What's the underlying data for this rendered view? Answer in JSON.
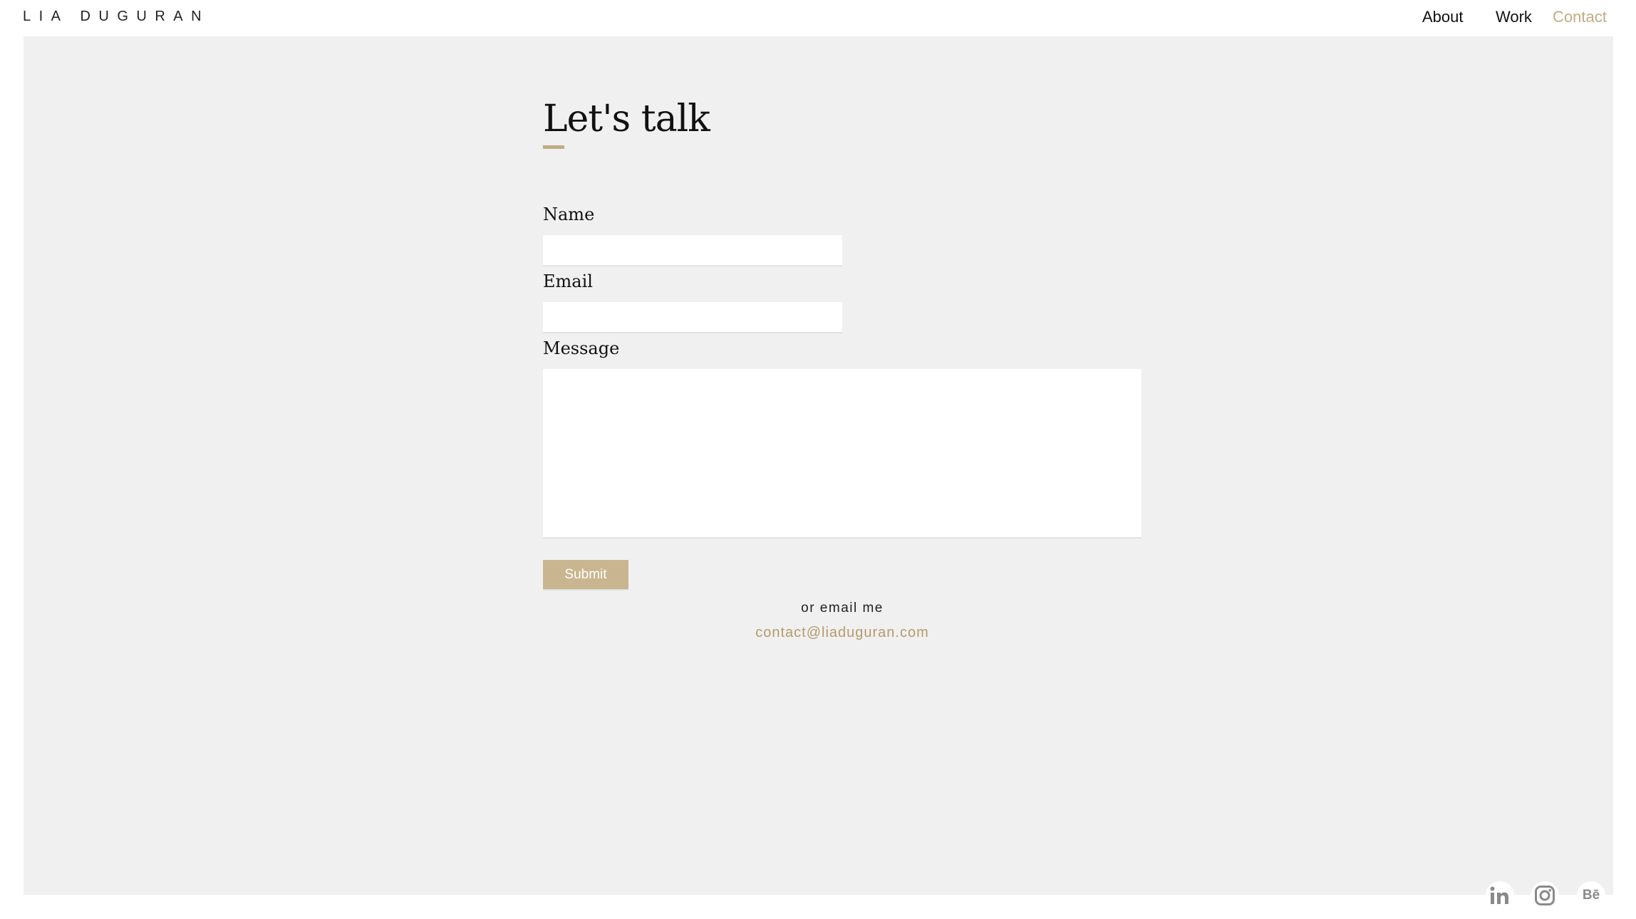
{
  "header": {
    "brand": "LIA DUGURAN",
    "nav": [
      {
        "label": "About"
      },
      {
        "label": "Work"
      },
      {
        "label": "Contact",
        "active": true
      }
    ]
  },
  "form": {
    "title": "Let's talk",
    "name_label": "Name",
    "name_value": "",
    "email_label": "Email",
    "email_value": "",
    "message_label": "Message",
    "message_value": "",
    "submit_label": "Submit"
  },
  "alt_contact": {
    "text": "or email me",
    "email": "contact@liaduguran.com"
  },
  "social": [
    {
      "icon": "linkedin-icon",
      "text": "in"
    },
    {
      "icon": "instagram-icon"
    },
    {
      "icon": "behance-icon",
      "text": "Bē"
    }
  ],
  "colors": {
    "accent": "#c2ac82",
    "panel": "#f0f0f0",
    "button": "#c9b690",
    "email_link": "#b59a6a",
    "icon": "#8a8a8a"
  }
}
